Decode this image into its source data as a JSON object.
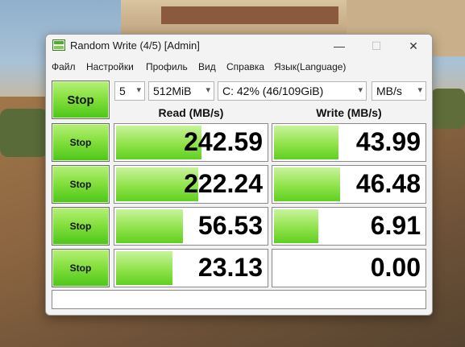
{
  "window": {
    "title": "Random Write (4/5) [Admin]",
    "controls": {
      "minimize": "—",
      "maximize": "☐",
      "close": "✕"
    }
  },
  "menu": [
    "Файл",
    "Настройки",
    "Профиль",
    "Вид",
    "Справка",
    "Язык(Language)"
  ],
  "toolbar": {
    "stop_label": "Stop",
    "count": "5",
    "size": "512MiB",
    "drive": "C: 42% (46/109GiB)",
    "unit": "MB/s"
  },
  "columns": {
    "read": "Read (MB/s)",
    "write": "Write (MB/s)"
  },
  "rows": [
    {
      "button": "Stop",
      "read": "242.59",
      "write": "43.99",
      "read_fill": 0.58,
      "write_fill": 0.44
    },
    {
      "button": "Stop",
      "read": "222.24",
      "write": "46.48",
      "read_fill": 0.56,
      "write_fill": 0.45
    },
    {
      "button": "Stop",
      "read": "56.53",
      "write": "6.91",
      "read_fill": 0.46,
      "write_fill": 0.31
    },
    {
      "button": "Stop",
      "read": "23.13",
      "write": "0.00",
      "read_fill": 0.39,
      "write_fill": 0.0
    }
  ],
  "status": "",
  "colors": {
    "accent_green": "#5fcf21",
    "window_bg": "#f3f3f3"
  }
}
